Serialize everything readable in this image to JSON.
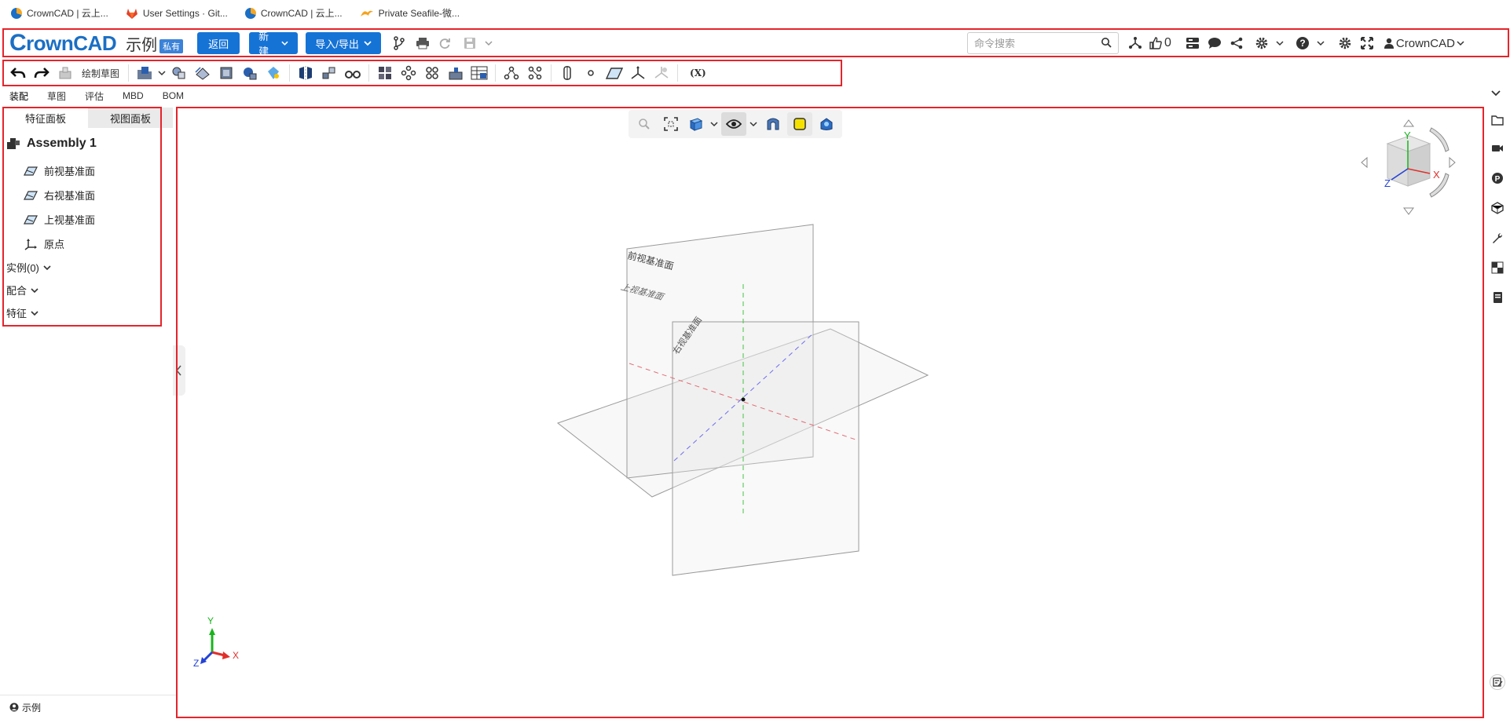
{
  "bookmarks": [
    {
      "label": "CrownCAD | 云上...",
      "icon": "crowncad-logo-icon"
    },
    {
      "label": "User Settings · Git...",
      "icon": "gitlab-fox-icon"
    },
    {
      "label": "CrownCAD | 云上...",
      "icon": "crowncad-logo-icon"
    },
    {
      "label": "Private Seafile-微...",
      "icon": "seafile-icon"
    }
  ],
  "header": {
    "logo_c": "C",
    "logo_rest": "rownCAD",
    "doc_title": "示例",
    "private_tag": "私有",
    "back_label": "返回",
    "new_label": "新建",
    "import_export_label": "导入/导出",
    "search_placeholder": "命令搜索",
    "like_count": "0",
    "user_name": "CrownCAD"
  },
  "toolbar": {
    "sketch_label": "绘制草图",
    "variables_label": "(X)"
  },
  "modules": [
    "装配",
    "草图",
    "评估",
    "MBD",
    "BOM"
  ],
  "panel": {
    "tab_features": "特征面板",
    "tab_view": "视图面板",
    "root": "Assembly 1",
    "items": [
      "前视基准面",
      "右视基准面",
      "上视基准面",
      "原点"
    ],
    "groups": [
      "实例(0)",
      "配合",
      "特征"
    ]
  },
  "viewport": {
    "plane_front": "前视基准面",
    "plane_top": "上视基准面",
    "plane_right": "右视基准面",
    "triad": {
      "x": "X",
      "y": "Y",
      "z": "Z"
    },
    "cube_axes": {
      "x": "X",
      "y": "Y",
      "z": "Z"
    }
  },
  "status": {
    "doc_name": "示例"
  },
  "colors": {
    "accent": "#1673d6",
    "annotation": "#e5242b",
    "axis_x": "#e0302b",
    "axis_y": "#19b31e",
    "axis_z": "#2342d6"
  }
}
